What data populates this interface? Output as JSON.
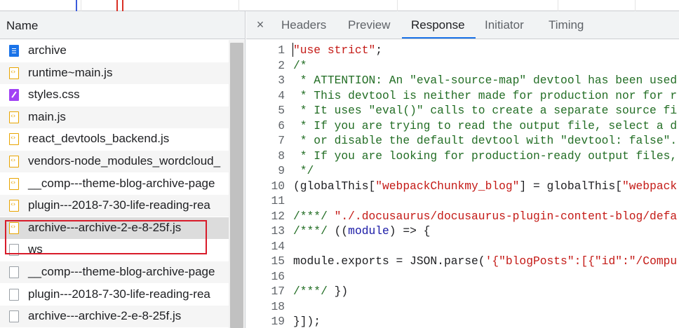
{
  "name_header": "Name",
  "files": [
    {
      "label": "archive",
      "type": "doc",
      "selected": false,
      "alt": false
    },
    {
      "label": "runtime~main.js",
      "type": "js",
      "selected": false,
      "alt": true
    },
    {
      "label": "styles.css",
      "type": "css",
      "selected": false,
      "alt": false
    },
    {
      "label": "main.js",
      "type": "js",
      "selected": false,
      "alt": true
    },
    {
      "label": "react_devtools_backend.js",
      "type": "js",
      "selected": false,
      "alt": false
    },
    {
      "label": "vendors-node_modules_wordcloud_",
      "type": "js",
      "selected": false,
      "alt": true
    },
    {
      "label": "__comp---theme-blog-archive-page",
      "type": "js",
      "selected": false,
      "alt": false
    },
    {
      "label": "plugin---2018-7-30-life-reading-rea",
      "type": "js",
      "selected": false,
      "alt": true
    },
    {
      "label": "archive---archive-2-e-8-25f.js",
      "type": "js",
      "selected": true,
      "alt": false
    },
    {
      "label": "ws",
      "type": "ws",
      "selected": false,
      "alt": false
    },
    {
      "label": "__comp---theme-blog-archive-page",
      "type": "ws",
      "selected": false,
      "alt": true
    },
    {
      "label": "plugin---2018-7-30-life-reading-rea",
      "type": "ws",
      "selected": false,
      "alt": false
    },
    {
      "label": "archive---archive-2-e-8-25f.js",
      "type": "ws",
      "selected": false,
      "alt": true
    }
  ],
  "tabs": [
    {
      "label": "Headers",
      "active": false
    },
    {
      "label": "Preview",
      "active": false
    },
    {
      "label": "Response",
      "active": true
    },
    {
      "label": "Initiator",
      "active": false
    },
    {
      "label": "Timing",
      "active": false
    }
  ],
  "close_icon": "×",
  "code_lines": [
    {
      "n": "1",
      "segs": [
        {
          "t": "\"use strict\"",
          "c": "str"
        },
        {
          "t": ";",
          "c": "pl"
        }
      ]
    },
    {
      "n": "2",
      "segs": [
        {
          "t": "/*",
          "c": "com"
        }
      ]
    },
    {
      "n": "3",
      "segs": [
        {
          "t": " * ATTENTION: An \"eval-source-map\" devtool has been used",
          "c": "com"
        }
      ]
    },
    {
      "n": "4",
      "segs": [
        {
          "t": " * This devtool is neither made for production nor for r",
          "c": "com"
        }
      ]
    },
    {
      "n": "5",
      "segs": [
        {
          "t": " * It uses \"eval()\" calls to create a separate source fi",
          "c": "com"
        }
      ]
    },
    {
      "n": "6",
      "segs": [
        {
          "t": " * If you are trying to read the output file, select a d",
          "c": "com"
        }
      ]
    },
    {
      "n": "7",
      "segs": [
        {
          "t": " * or disable the default devtool with \"devtool: false\".",
          "c": "com"
        }
      ]
    },
    {
      "n": "8",
      "segs": [
        {
          "t": " * If you are looking for production-ready output files,",
          "c": "com"
        }
      ]
    },
    {
      "n": "9",
      "segs": [
        {
          "t": " */",
          "c": "com"
        }
      ]
    },
    {
      "n": "10",
      "segs": [
        {
          "t": "(globalThis[",
          "c": "pl"
        },
        {
          "t": "\"webpackChunkmy_blog\"",
          "c": "str"
        },
        {
          "t": "] = globalThis[",
          "c": "pl"
        },
        {
          "t": "\"webpack",
          "c": "str"
        }
      ]
    },
    {
      "n": "11",
      "segs": []
    },
    {
      "n": "12",
      "segs": [
        {
          "t": "/***/ ",
          "c": "com"
        },
        {
          "t": "\"./.docusaurus/docusaurus-plugin-content-blog/defa",
          "c": "str"
        }
      ]
    },
    {
      "n": "13",
      "segs": [
        {
          "t": "/***/ ",
          "c": "com"
        },
        {
          "t": "((",
          "c": "pl"
        },
        {
          "t": "module",
          "c": "kw"
        },
        {
          "t": ") => {",
          "c": "pl"
        }
      ]
    },
    {
      "n": "14",
      "segs": []
    },
    {
      "n": "15",
      "segs": [
        {
          "t": "module.exports = JSON.parse(",
          "c": "pl"
        },
        {
          "t": "'{\"blogPosts\":[{\"id\":\"/Compu",
          "c": "str"
        }
      ]
    },
    {
      "n": "16",
      "segs": []
    },
    {
      "n": "17",
      "segs": [
        {
          "t": "/***/ ",
          "c": "com"
        },
        {
          "t": "})",
          "c": "pl"
        }
      ]
    },
    {
      "n": "18",
      "segs": []
    },
    {
      "n": "19",
      "segs": [
        {
          "t": "}]);",
          "c": "pl"
        }
      ]
    }
  ],
  "colors": {
    "accent": "#1a73e8",
    "highlight_box": "#d81b2a",
    "selected_row": "#dcdcdc"
  }
}
